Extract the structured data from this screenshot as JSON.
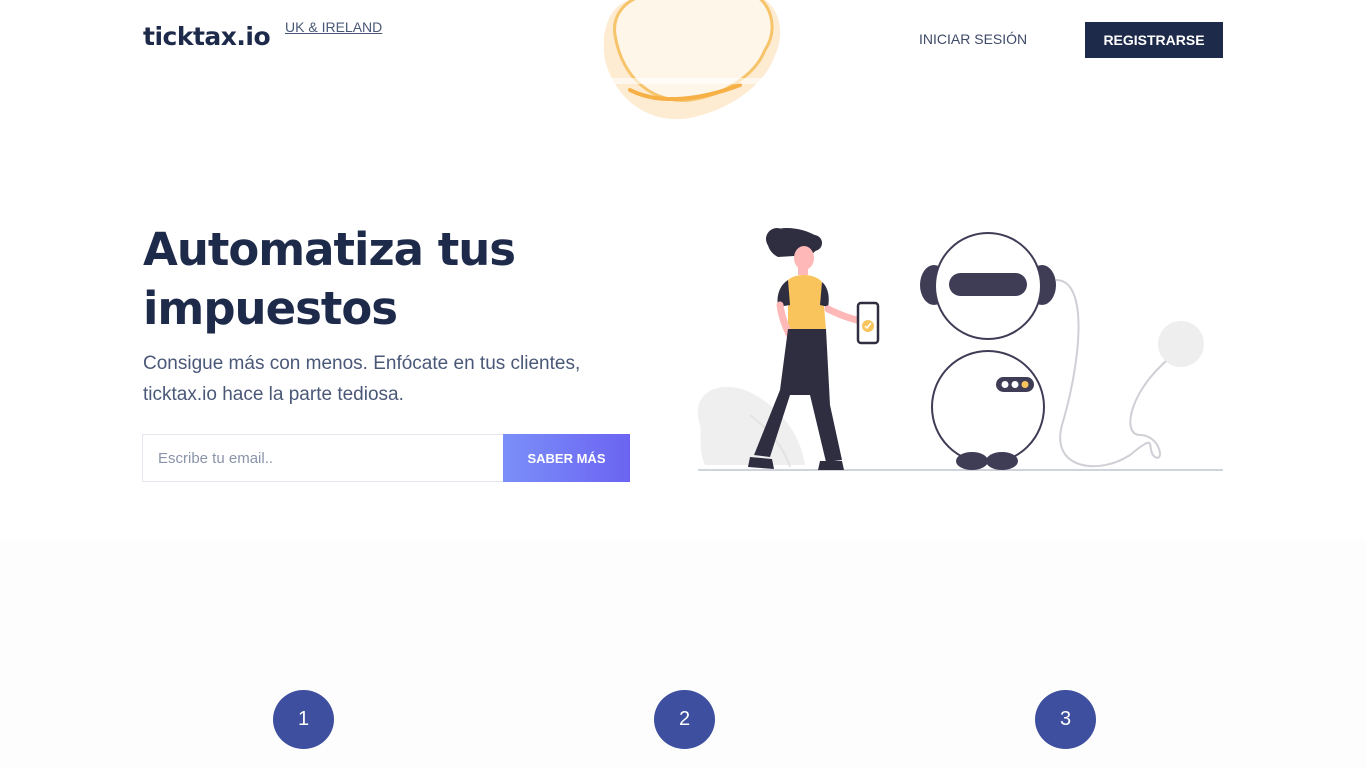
{
  "header": {
    "logo": "ticktax.io",
    "region_link": "UK & IRELAND",
    "login_label": "INICIAR SESIÓN",
    "register_label": "REGISTRARSE"
  },
  "hero": {
    "title": "Automatiza tus impuestos",
    "subtitle": "Consigue más con menos. Enfócate en tus clientes, ticktax.io hace la parte tediosa.",
    "email_placeholder": "Escribe tu email..",
    "cta_label": "SABER MÁS"
  },
  "steps": [
    {
      "number": "1"
    },
    {
      "number": "2"
    },
    {
      "number": "3"
    }
  ],
  "colors": {
    "brand_dark": "#1e2a4a",
    "cta_gradient_start": "#7b8ff8",
    "cta_gradient_end": "#6b64f2",
    "step_circle": "#3d4f9e",
    "accent_yellow": "#f9c45c"
  }
}
